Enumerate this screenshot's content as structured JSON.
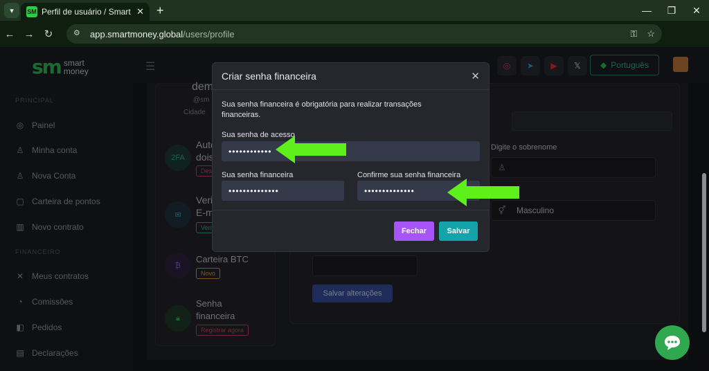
{
  "browser": {
    "tab_title": "Perfil de usuário / Smart Money",
    "favicon_text": "SM",
    "url_host": "app.smartmoney.global",
    "url_path": "/users/profile",
    "profile_initial": "S"
  },
  "sidebar": {
    "brand_mark": "sm",
    "brand_line1": "smart",
    "brand_line2": "money",
    "section_principal": "PRINCIPAL",
    "section_financeiro": "FINANCEIRO",
    "items": [
      {
        "label": "Painel",
        "icon": "palette-icon"
      },
      {
        "label": "Minha conta",
        "icon": "user-icon"
      },
      {
        "label": "Nova Conta",
        "icon": "user-plus-icon"
      },
      {
        "label": "Carteira de pontos",
        "icon": "wallet-icon"
      },
      {
        "label": "Novo contrato",
        "icon": "chart-icon"
      },
      {
        "label": "Meus contratos",
        "icon": "cross-icon"
      },
      {
        "label": "Comissões",
        "icon": "coins-icon"
      },
      {
        "label": "Pedidos",
        "icon": "bag-icon"
      },
      {
        "label": "Declarações",
        "icon": "doc-icon"
      }
    ]
  },
  "topbar": {
    "language": "Português"
  },
  "profile": {
    "name_partial": "dem",
    "handle_partial": "@sm",
    "city_partial": "Cidade",
    "twofa_icon": "2FA",
    "twofa_title_1": "Aute",
    "twofa_title_2": "dois",
    "twofa_pill": "Desa",
    "email_title_1": "Verif",
    "email_title_2": "E-m",
    "email_pill": "Verif",
    "btc_title": "Carteira BTC",
    "btc_pill": "Novo",
    "fin_title_1": "Senha",
    "fin_title_2": "financeira",
    "fin_pill": "Registrar agora"
  },
  "form": {
    "lastname_label": "Digite o sobrenome",
    "gender_value": "Masculino",
    "save_changes": "Salvar alterações"
  },
  "modal": {
    "title": "Criar senha financeira",
    "description": "Sua senha financeira é obrigatória para realizar transações financeiras.",
    "access_label": "Sua senha de acesso",
    "access_value": "••••••••••••",
    "financial_label": "Sua senha financeira",
    "financial_value": "••••••••••••••",
    "confirm_label": "Confirme sua senha financeira",
    "confirm_value": "••••••••••••••",
    "close_label": "Fechar",
    "save_label": "Salvar"
  },
  "colors": {
    "arrow": "#5ef01a",
    "close_button": "#a855f7",
    "save_button": "#14a3a8",
    "brand_green": "#2fbf5a"
  }
}
